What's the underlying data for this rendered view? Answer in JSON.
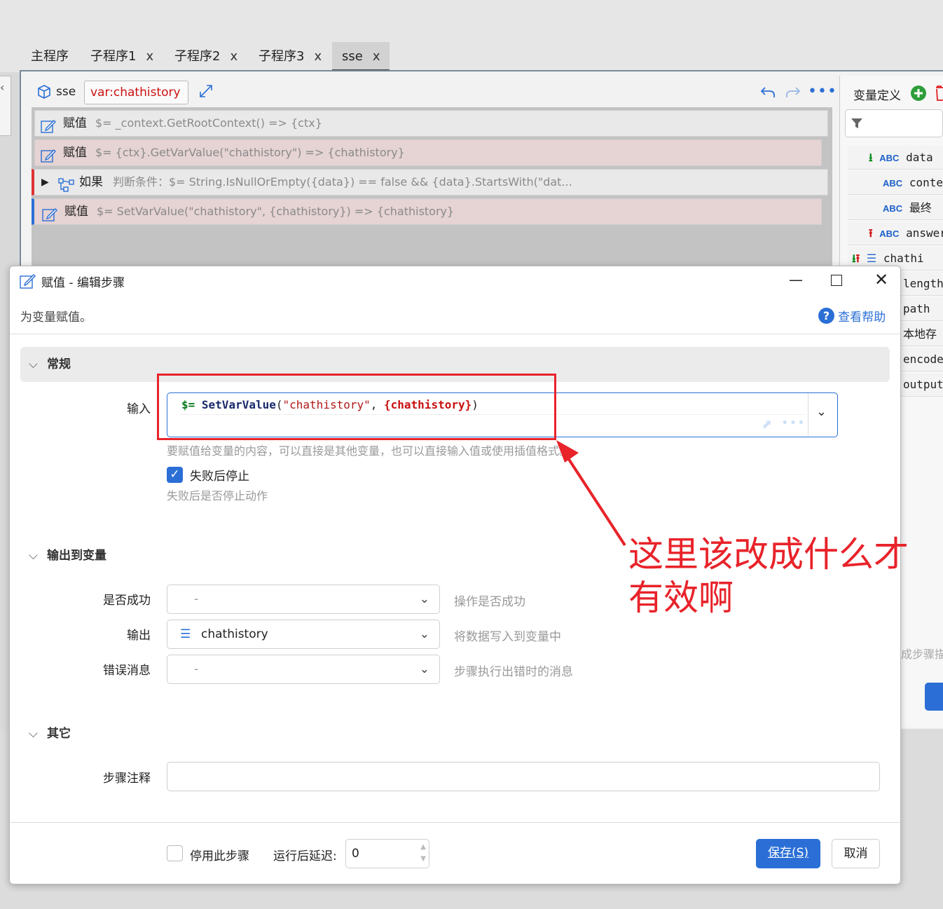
{
  "tabs": [
    {
      "label": "主程序",
      "closable": false
    },
    {
      "label": "子程序1",
      "closable": true
    },
    {
      "label": "子程序2",
      "closable": true
    },
    {
      "label": "子程序3",
      "closable": true
    },
    {
      "label": "sse",
      "closable": true,
      "active": true
    }
  ],
  "tab_close_glyph": "x",
  "toolbar": {
    "name": "sse",
    "var_label": "var:chathistory"
  },
  "steps": [
    {
      "label": "赋值",
      "expr": "$= _context.GetRootContext()  => {ctx}"
    },
    {
      "label": "赋值",
      "expr": "$= {ctx}.GetVarValue(\"chathistory\") => {chathistory}"
    },
    {
      "label": "如果",
      "expr": "判断条件：$= String.IsNullOrEmpty({data}) == false  && {data}.StartsWith(\"dat..."
    },
    {
      "label": "赋值",
      "expr": "$= SetVarValue(\"chathistory\", {chathistory}) => {chathistory}"
    }
  ],
  "var_panel": {
    "title": "变量定义",
    "items": [
      {
        "abc": "ABC",
        "name": "data"
      },
      {
        "abc": "ABC",
        "name": "conter"
      },
      {
        "abc": "ABC",
        "name": "最终"
      },
      {
        "abc": "ABC",
        "name": "answer"
      },
      {
        "abc": "",
        "name": "chathi"
      },
      {
        "abc": "",
        "name": "length"
      },
      {
        "abc": "",
        "name": "path"
      },
      {
        "abc": "",
        "name": "本地存"
      },
      {
        "abc": "",
        "name": "encode"
      },
      {
        "abc": "",
        "name": "output"
      }
    ],
    "truncated_hint": "成步骤描"
  },
  "dialog": {
    "title": "赋值  -  编辑步骤",
    "description": "为变量赋值。",
    "help_link": "查看帮助",
    "general": {
      "header": "常规",
      "input_label": "输入",
      "input_prefix": "$=",
      "input_func": "SetVarValue",
      "input_open": "(",
      "input_string": "\"chathistory\"",
      "input_comma": ", ",
      "input_var": "{chathistory}",
      "input_close": ")",
      "input_hint": "要赋值给变量的内容，可以直接是其他变量，也可以直接输入值或使用插值格式。",
      "stop_on_fail_label": "失败后停止",
      "stop_on_fail_checked": true,
      "stop_on_fail_hint": "失败后是否停止动作"
    },
    "output": {
      "header": "输出到变量",
      "success_label": "是否成功",
      "success_value": "-",
      "success_hint": "操作是否成功",
      "output_label": "输出",
      "output_value": "chathistory",
      "output_hint": "将数据写入到变量中",
      "error_label": "错误消息",
      "error_value": "-",
      "error_hint": "步骤执行出错时的消息"
    },
    "other": {
      "header": "其它",
      "note_label": "步骤注释",
      "note_value": ""
    },
    "footer": {
      "disable_label": "停用此步骤",
      "disable_checked": false,
      "delay_label": "运行后延迟:",
      "delay_value": "0",
      "save_label": "保存(S)",
      "cancel_label": "取消"
    }
  },
  "annotation": {
    "line1": "这里该改成什么才",
    "line2": "有效啊",
    "color": "#e8232a"
  },
  "colors": {
    "accent": "#2b6fd6",
    "error_red": "#cc1111"
  }
}
